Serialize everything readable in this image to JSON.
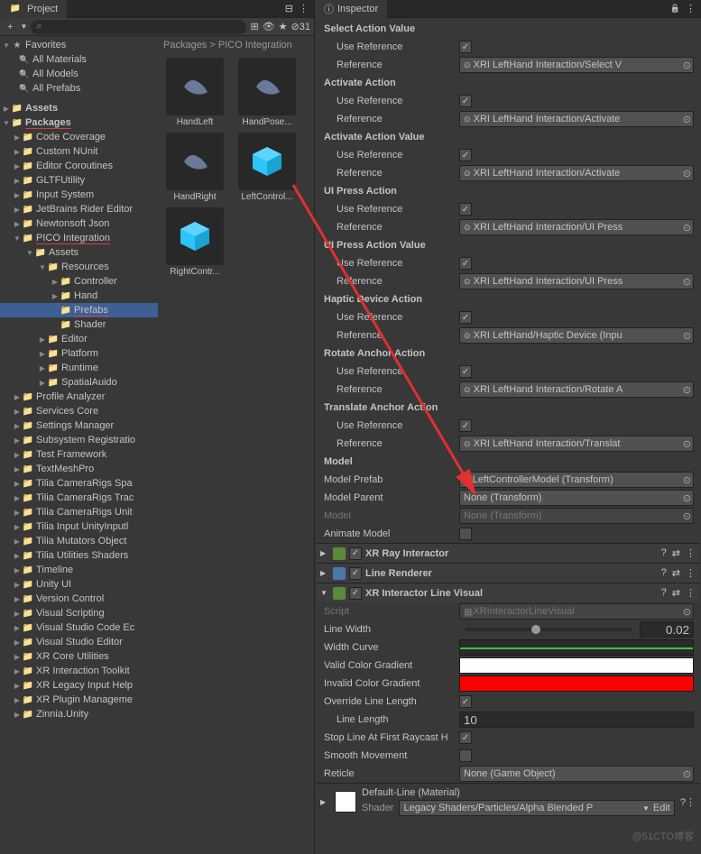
{
  "project": {
    "tab_title": "Project",
    "toolbar": {
      "add": "+",
      "search_placeholder": "",
      "hidden_icon": "👁",
      "count": "31"
    },
    "favorites": {
      "label": "Favorites",
      "items": [
        "All Materials",
        "All Models",
        "All Prefabs"
      ]
    },
    "assets_label": "Assets",
    "packages_label": "Packages",
    "packages": [
      "Code Coverage",
      "Custom NUnit",
      "Editor Coroutines",
      "GLTFUtility",
      "Input System",
      "JetBrains Rider Editor",
      "Newtonsoft Json"
    ],
    "pico_integration": {
      "label": "PICO Integration",
      "assets_label": "Assets",
      "resources_label": "Resources",
      "resources": [
        "Controller",
        "Hand",
        "Prefabs",
        "Shader"
      ]
    },
    "more_packages": [
      "Editor",
      "Platform",
      "Runtime",
      "SpatialAuido",
      "Profile Analyzer",
      "Services Core",
      "Settings Manager",
      "Subsystem Registratio",
      "Test Framework",
      "TextMeshPro",
      "Tilia CameraRigs Spa",
      "Tilia CameraRigs Trac",
      "Tilia CameraRigs Unit",
      "Tilia Input UnityInputl",
      "Tilia Mutators Object",
      "Tilia Utilities Shaders",
      "Timeline",
      "Unity UI",
      "Version Control",
      "Visual Scripting",
      "Visual Studio Code Ec",
      "Visual Studio Editor",
      "XR Core Utilities",
      "XR Interaction Toolkit",
      "XR Legacy Input Help",
      "XR Plugin Manageme",
      "Zinnia.Unity"
    ],
    "breadcrumb": [
      "Packages",
      "PICO Integration"
    ],
    "grid_items": [
      {
        "name": "HandLeft",
        "type": "hand"
      },
      {
        "name": "HandPose...",
        "type": "hand"
      },
      {
        "name": "HandRight",
        "type": "hand"
      },
      {
        "name": "LeftControl...",
        "type": "prefab"
      },
      {
        "name": "RightContr...",
        "type": "prefab"
      }
    ]
  },
  "inspector": {
    "tab_title": "Inspector",
    "sections": [
      {
        "header": "Select Action Value",
        "use_ref": true,
        "ref": "XRI LeftHand Interaction/Select V"
      },
      {
        "header": "Activate Action",
        "use_ref": true,
        "ref": "XRI LeftHand Interaction/Activate"
      },
      {
        "header": "Activate Action Value",
        "use_ref": true,
        "ref": "XRI LeftHand Interaction/Activate"
      },
      {
        "header": "UI Press Action",
        "use_ref": true,
        "ref": "XRI LeftHand Interaction/UI Press"
      },
      {
        "header": "UI Press Action Value",
        "use_ref": true,
        "ref": "XRI LeftHand Interaction/UI Press"
      },
      {
        "header": "Haptic Device Action",
        "use_ref": true,
        "ref": "XRI LeftHand/Haptic Device (Inpu"
      },
      {
        "header": "Rotate Anchor Action",
        "use_ref": true,
        "ref": "XRI LeftHand Interaction/Rotate A"
      },
      {
        "header": "Translate Anchor Action",
        "use_ref": true,
        "ref": "XRI LeftHand Interaction/Translat"
      }
    ],
    "labels": {
      "use_reference": "Use Reference",
      "reference": "Reference"
    },
    "model": {
      "header": "Model",
      "prefab_label": "Model Prefab",
      "prefab_value": "LeftControllerModel (Transform)",
      "parent_label": "Model Parent",
      "parent_value": "None (Transform)",
      "model_label": "Model",
      "model_value": "None (Transform)",
      "animate_label": "Animate Model"
    },
    "components": {
      "ray": "XR Ray Interactor",
      "line": "Line Renderer",
      "visual": "XR Interactor Line Visual"
    },
    "visual_props": {
      "script_label": "Script",
      "script_value": "XRInteractorLineVisual",
      "line_width_label": "Line Width",
      "line_width_value": "0.02",
      "width_curve_label": "Width Curve",
      "valid_color_label": "Valid Color Gradient",
      "invalid_color_label": "Invalid Color Gradient",
      "override_label": "Override Line Length",
      "line_length_label": "Line Length",
      "line_length_value": "10",
      "stop_label": "Stop Line At First Raycast H",
      "smooth_label": "Smooth Movement",
      "reticle_label": "Reticle",
      "reticle_value": "None (Game Object)"
    },
    "material": {
      "name": "Default-Line (Material)",
      "shader_label": "Shader",
      "shader_value": "Legacy Shaders/Particles/Alpha Blended P"
    }
  },
  "watermark": "@51CTO博客"
}
